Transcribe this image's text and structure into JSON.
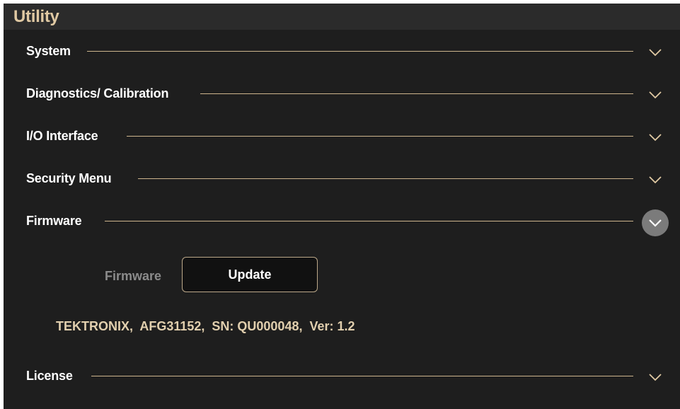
{
  "title": "Utility",
  "sections": [
    {
      "label": "System",
      "chevron_icon": "chevron-down-icon"
    },
    {
      "label": "Diagnostics/ Calibration",
      "chevron_icon": "chevron-down-icon"
    },
    {
      "label": "I/O Interface",
      "chevron_icon": "chevron-down-icon"
    },
    {
      "label": "Security Menu",
      "chevron_icon": "chevron-down-icon"
    },
    {
      "label": "Firmware",
      "chevron_icon": "chevron-down-icon",
      "expanded": true
    },
    {
      "label": "License",
      "chevron_icon": "chevron-down-icon"
    }
  ],
  "firmware": {
    "label": "Firmware",
    "update_button": "Update",
    "device_info": "TEKTRONIX,  AFG31152,  SN: QU000048,  Ver: 1.2"
  },
  "colors": {
    "background": "#1e1e1e",
    "header_background": "#2b2b2b",
    "accent": "#cdb58d",
    "title_text": "#e0c9a3",
    "section_text": "#ffffff",
    "muted_text": "#8b8b8b"
  }
}
